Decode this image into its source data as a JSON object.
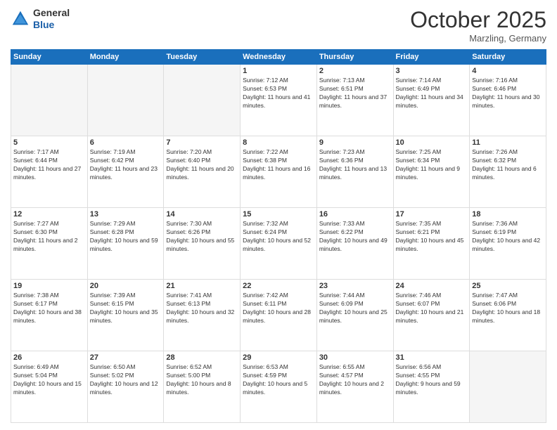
{
  "header": {
    "logo_line1": "General",
    "logo_line2": "Blue",
    "month_title": "October 2025",
    "location": "Marzling, Germany"
  },
  "weekdays": [
    "Sunday",
    "Monday",
    "Tuesday",
    "Wednesday",
    "Thursday",
    "Friday",
    "Saturday"
  ],
  "weeks": [
    [
      {
        "day": "",
        "empty": true
      },
      {
        "day": "",
        "empty": true
      },
      {
        "day": "",
        "empty": true
      },
      {
        "day": "1",
        "sunrise": "7:12 AM",
        "sunset": "6:53 PM",
        "daylight": "11 hours and 41 minutes."
      },
      {
        "day": "2",
        "sunrise": "7:13 AM",
        "sunset": "6:51 PM",
        "daylight": "11 hours and 37 minutes."
      },
      {
        "day": "3",
        "sunrise": "7:14 AM",
        "sunset": "6:49 PM",
        "daylight": "11 hours and 34 minutes."
      },
      {
        "day": "4",
        "sunrise": "7:16 AM",
        "sunset": "6:46 PM",
        "daylight": "11 hours and 30 minutes."
      }
    ],
    [
      {
        "day": "5",
        "sunrise": "7:17 AM",
        "sunset": "6:44 PM",
        "daylight": "11 hours and 27 minutes."
      },
      {
        "day": "6",
        "sunrise": "7:19 AM",
        "sunset": "6:42 PM",
        "daylight": "11 hours and 23 minutes."
      },
      {
        "day": "7",
        "sunrise": "7:20 AM",
        "sunset": "6:40 PM",
        "daylight": "11 hours and 20 minutes."
      },
      {
        "day": "8",
        "sunrise": "7:22 AM",
        "sunset": "6:38 PM",
        "daylight": "11 hours and 16 minutes."
      },
      {
        "day": "9",
        "sunrise": "7:23 AM",
        "sunset": "6:36 PM",
        "daylight": "11 hours and 13 minutes."
      },
      {
        "day": "10",
        "sunrise": "7:25 AM",
        "sunset": "6:34 PM",
        "daylight": "11 hours and 9 minutes."
      },
      {
        "day": "11",
        "sunrise": "7:26 AM",
        "sunset": "6:32 PM",
        "daylight": "11 hours and 6 minutes."
      }
    ],
    [
      {
        "day": "12",
        "sunrise": "7:27 AM",
        "sunset": "6:30 PM",
        "daylight": "11 hours and 2 minutes."
      },
      {
        "day": "13",
        "sunrise": "7:29 AM",
        "sunset": "6:28 PM",
        "daylight": "10 hours and 59 minutes."
      },
      {
        "day": "14",
        "sunrise": "7:30 AM",
        "sunset": "6:26 PM",
        "daylight": "10 hours and 55 minutes."
      },
      {
        "day": "15",
        "sunrise": "7:32 AM",
        "sunset": "6:24 PM",
        "daylight": "10 hours and 52 minutes."
      },
      {
        "day": "16",
        "sunrise": "7:33 AM",
        "sunset": "6:22 PM",
        "daylight": "10 hours and 49 minutes."
      },
      {
        "day": "17",
        "sunrise": "7:35 AM",
        "sunset": "6:21 PM",
        "daylight": "10 hours and 45 minutes."
      },
      {
        "day": "18",
        "sunrise": "7:36 AM",
        "sunset": "6:19 PM",
        "daylight": "10 hours and 42 minutes."
      }
    ],
    [
      {
        "day": "19",
        "sunrise": "7:38 AM",
        "sunset": "6:17 PM",
        "daylight": "10 hours and 38 minutes."
      },
      {
        "day": "20",
        "sunrise": "7:39 AM",
        "sunset": "6:15 PM",
        "daylight": "10 hours and 35 minutes."
      },
      {
        "day": "21",
        "sunrise": "7:41 AM",
        "sunset": "6:13 PM",
        "daylight": "10 hours and 32 minutes."
      },
      {
        "day": "22",
        "sunrise": "7:42 AM",
        "sunset": "6:11 PM",
        "daylight": "10 hours and 28 minutes."
      },
      {
        "day": "23",
        "sunrise": "7:44 AM",
        "sunset": "6:09 PM",
        "daylight": "10 hours and 25 minutes."
      },
      {
        "day": "24",
        "sunrise": "7:46 AM",
        "sunset": "6:07 PM",
        "daylight": "10 hours and 21 minutes."
      },
      {
        "day": "25",
        "sunrise": "7:47 AM",
        "sunset": "6:06 PM",
        "daylight": "10 hours and 18 minutes."
      }
    ],
    [
      {
        "day": "26",
        "sunrise": "6:49 AM",
        "sunset": "5:04 PM",
        "daylight": "10 hours and 15 minutes."
      },
      {
        "day": "27",
        "sunrise": "6:50 AM",
        "sunset": "5:02 PM",
        "daylight": "10 hours and 12 minutes."
      },
      {
        "day": "28",
        "sunrise": "6:52 AM",
        "sunset": "5:00 PM",
        "daylight": "10 hours and 8 minutes."
      },
      {
        "day": "29",
        "sunrise": "6:53 AM",
        "sunset": "4:59 PM",
        "daylight": "10 hours and 5 minutes."
      },
      {
        "day": "30",
        "sunrise": "6:55 AM",
        "sunset": "4:57 PM",
        "daylight": "10 hours and 2 minutes."
      },
      {
        "day": "31",
        "sunrise": "6:56 AM",
        "sunset": "4:55 PM",
        "daylight": "9 hours and 59 minutes."
      },
      {
        "day": "",
        "empty": true
      }
    ]
  ]
}
